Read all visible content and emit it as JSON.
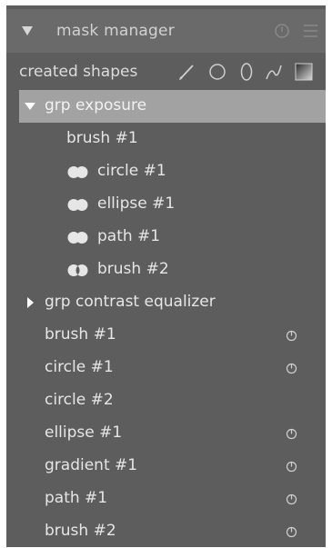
{
  "header": {
    "title": "mask manager"
  },
  "shapes_toolbar": {
    "label": "created shapes",
    "tools": [
      "brush-icon",
      "circle-icon",
      "ellipse-icon",
      "path-icon",
      "gradient-icon"
    ]
  },
  "tree": {
    "group1": {
      "label": "grp exposure",
      "expanded": true,
      "selected": true
    },
    "group1_items": [
      {
        "label": "brush #1",
        "mode_icon": "none"
      },
      {
        "label": "circle #1",
        "mode_icon": "union-icon"
      },
      {
        "label": "ellipse #1",
        "mode_icon": "union-icon"
      },
      {
        "label": "path #1",
        "mode_icon": "union-icon"
      },
      {
        "label": "brush #2",
        "mode_icon": "difference-icon"
      }
    ],
    "group2": {
      "label": "grp contrast equalizer",
      "expanded": false
    },
    "shapes": [
      {
        "label": "brush #1",
        "state_icon": "used-icon"
      },
      {
        "label": "circle #1",
        "state_icon": "used-icon"
      },
      {
        "label": "circle #2",
        "state_icon": "none"
      },
      {
        "label": "ellipse #1",
        "state_icon": "used-icon"
      },
      {
        "label": "gradient #1",
        "state_icon": "used-icon"
      },
      {
        "label": "path #1",
        "state_icon": "used-icon"
      },
      {
        "label": "brush #2",
        "state_icon": "used-icon"
      }
    ]
  },
  "colors": {
    "panel_bg": "#5d5d5d",
    "header_bg": "#6a6a6a",
    "selected_bg": "#a2a2a2",
    "text": "#e6e6e6"
  }
}
